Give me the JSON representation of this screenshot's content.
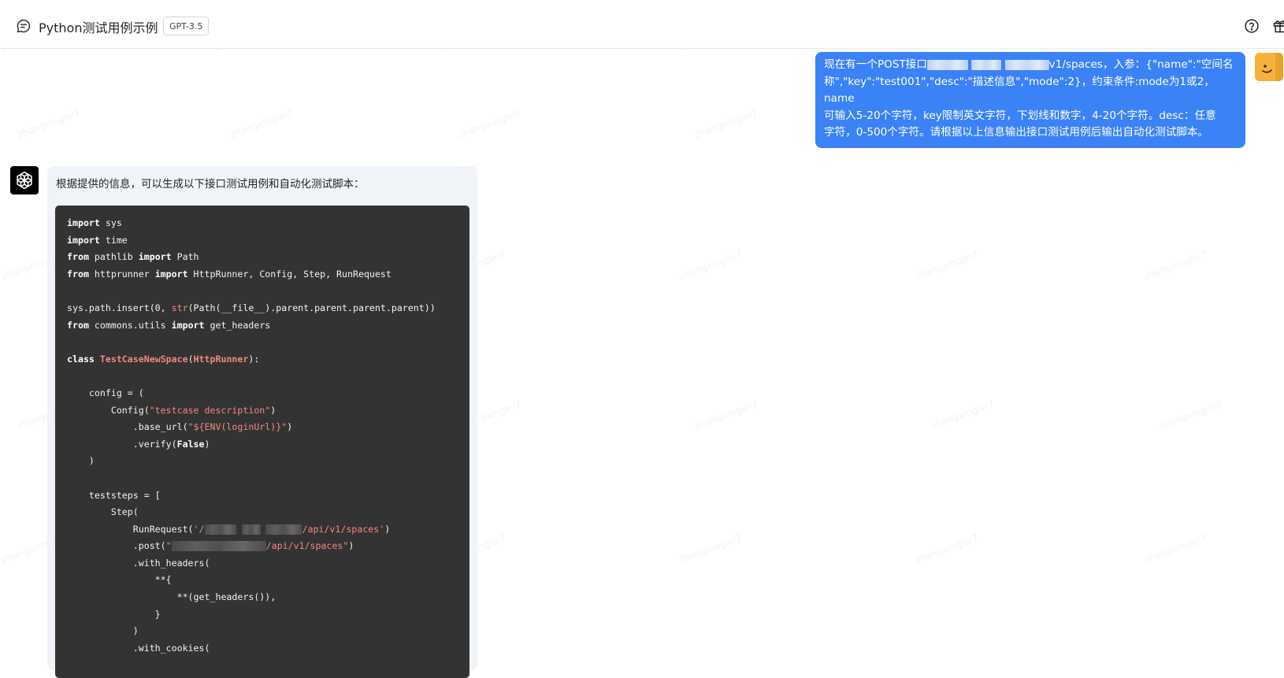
{
  "header": {
    "title": "Python测试用例示例",
    "model_badge": "GPT-3.5",
    "icons": [
      "chat-bubble-icon",
      "help-circle-icon",
      "gift-icon"
    ]
  },
  "watermark": "zhangxinglei7",
  "user_message": {
    "segments": {
      "line1_a": "现在有一个POST接口",
      "line1_b": "v1/spaces，入参：{\"name\":\"空间名",
      "line2": "称\",\"key\":\"test001\",\"desc\":\"描述信息\",\"mode\":2}，约束条件:mode为1或2，name",
      "line3": "可输入5-20个字符，key限制英文字符，下划线和数字，4-20个字符。desc：任意",
      "line4": "字符，0-500个字符。请根据以上信息输出接口测试用例后输出自动化测试脚本。"
    },
    "bubble_color": "#3b82f6"
  },
  "assistant_message": {
    "intro": "根据提供的信息，可以生成以下接口测试用例和自动化测试脚本：",
    "code": {
      "l1_kw": "import",
      "l1_rest": " sys",
      "l2_kw": "import",
      "l2_rest": " time",
      "l3_kw1": "from",
      "l3_mid": " pathlib ",
      "l3_kw2": "import",
      "l3_rest": " Path",
      "l4_kw1": "from",
      "l4_mid": " httprunner ",
      "l4_kw2": "import",
      "l4_rest": " HttpRunner, Config, Step, RunRequest",
      "l6_a": "sys.path.insert(0, ",
      "l6_str": "str",
      "l6_b": "(Path(__file__).parent.parent.parent.parent))",
      "l7_kw1": "from",
      "l7_mid": " commons.utils ",
      "l7_kw2": "import",
      "l7_rest": " get_headers",
      "l9_kw": "class",
      "l9_cls": "TestCaseNewSpace",
      "l9_p1": "(",
      "l9_base": "HttpRunner",
      "l9_p2": "):",
      "l11": "    config = (",
      "l12_a": "        Config(",
      "l12_str": "\"testcase description\"",
      "l12_b": ")",
      "l13_a": "            .base_url(",
      "l13_str": "\"${ENV(loginUrl)}\"",
      "l13_b": ")",
      "l14_a": "            .verify(",
      "l14_bool": "False",
      "l14_b": ")",
      "l15": "    )",
      "l17": "    teststeps = [",
      "l18": "        Step(",
      "l19_a": "            RunRequest(",
      "l19_str1": "'/",
      "l19_str2": "/api/v1/spaces'",
      "l19_b": ")",
      "l20_a": "            .post(",
      "l20_str1": "\"",
      "l20_str2": "/api/v1/spaces\"",
      "l20_b": ")",
      "l21": "            .with_headers(",
      "l22": "                **{",
      "l23": "                    **(get_headers()),",
      "l24": "                }",
      "l25": "            )",
      "l26": "            .with_cookies("
    }
  },
  "colors": {
    "code_bg": "#333333",
    "string_color": "#f08a7c",
    "bot_bubble_bg": "#f0f3f8",
    "user_avatar_bg": "#f6b13b"
  }
}
